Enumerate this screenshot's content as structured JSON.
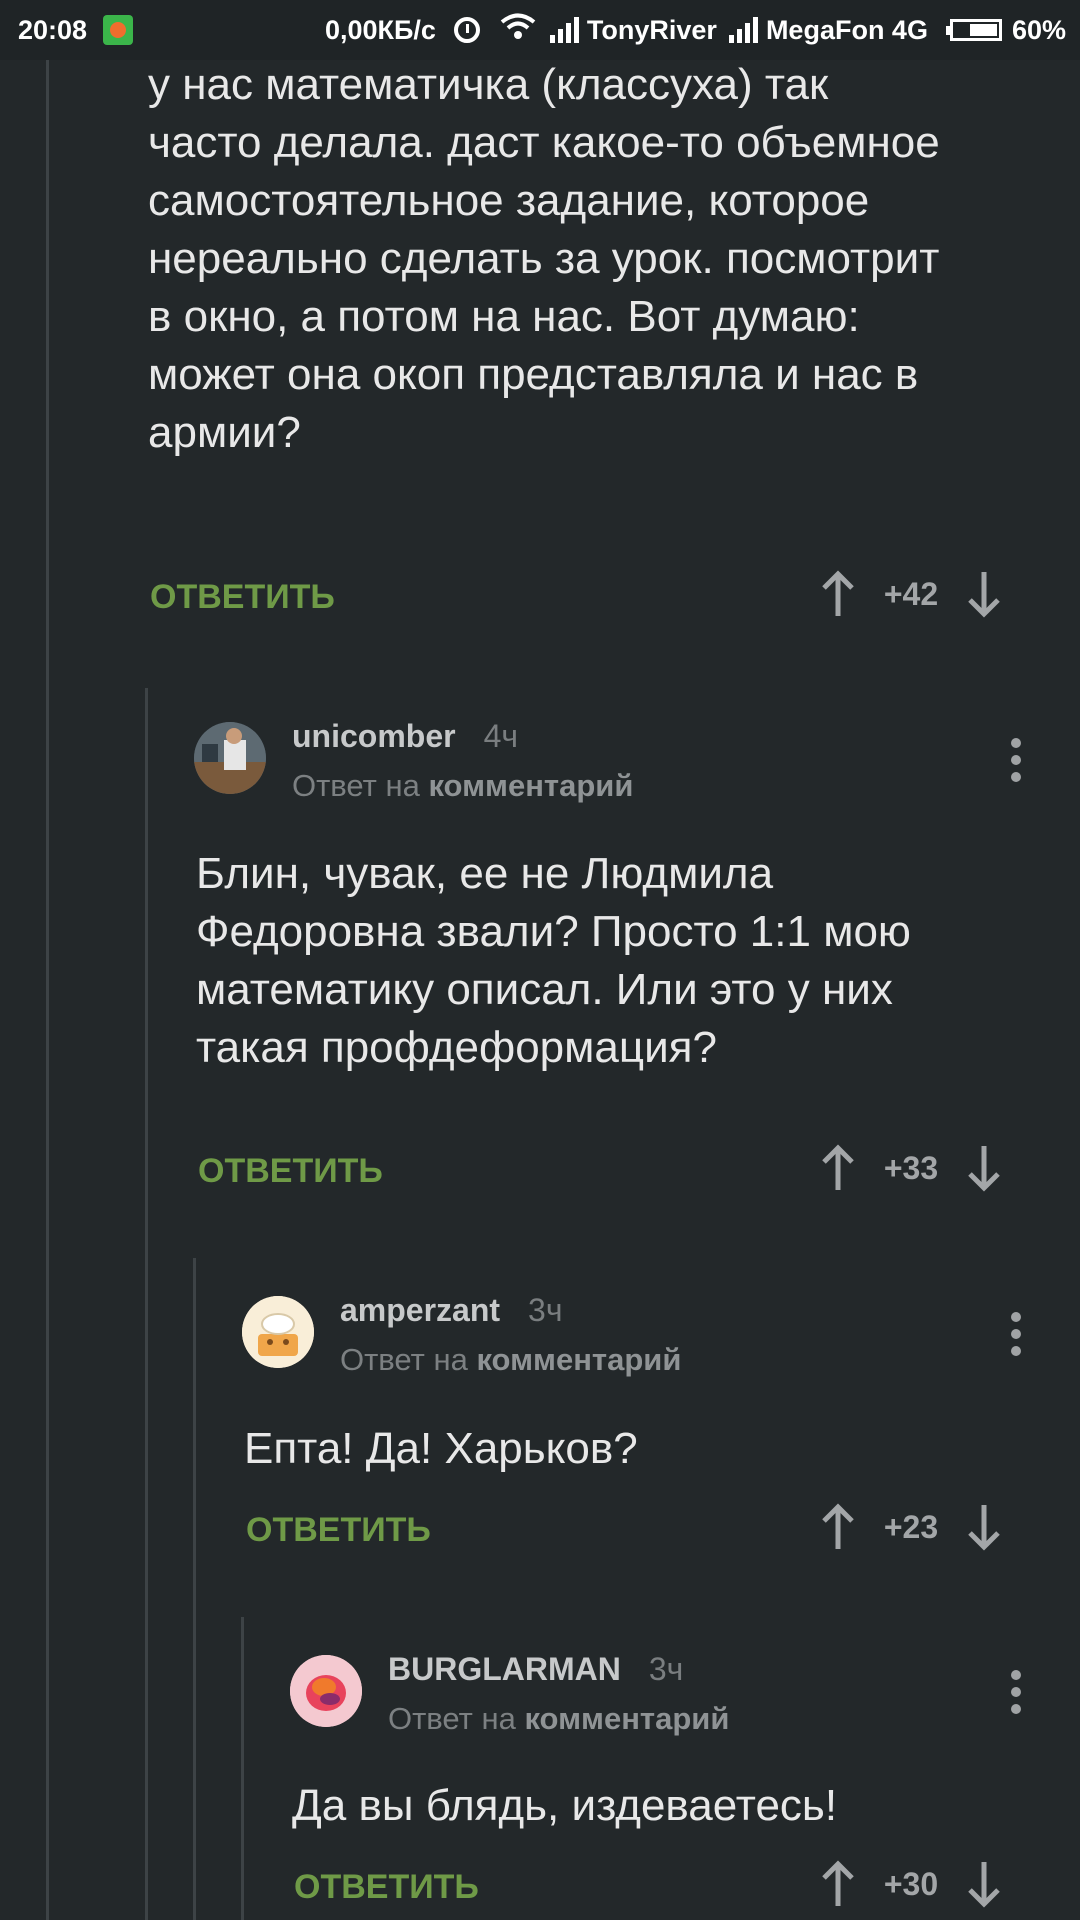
{
  "status_bar": {
    "time": "20:08",
    "speed": "0,00КБ/с",
    "carrier1": "TonyRiver",
    "carrier2": "MegaFon 4G",
    "battery": "60%",
    "battery_level": 0.6
  },
  "comments": [
    {
      "body": "у нас математичка (классуха) так\nчасто делала. даст какое-то объемное\nсамостоятельное задание, которое\nнереально сделать за урок. посмотрит\nв окно, а потом на нас. Вот думаю:\nможет она окоп представляла и нас в\nармии?",
      "reply_label": "ОТВЕТИТЬ",
      "score": "+42"
    },
    {
      "author": "unicomber",
      "time": "4ч",
      "reply_prefix": "Ответ на",
      "reply_target": "комментарий",
      "body": "Блин, чувак, ее не Людмила\nФедоровна звали? Просто 1:1 мою\nматематику описал. Или это у них\nтакая профдеформация?",
      "reply_label": "ОТВЕТИТЬ",
      "score": "+33"
    },
    {
      "author": "amperzant",
      "time": "3ч",
      "reply_prefix": "Ответ на",
      "reply_target": "комментарий",
      "body": "Епта! Да! Харьков?",
      "reply_label": "ОТВЕТИТЬ",
      "score": "+23"
    },
    {
      "author": "BURGLARMAN",
      "time": "3ч",
      "reply_prefix": "Ответ на",
      "reply_target": "комментарий",
      "body": "Да вы блядь, издеваетесь!",
      "reply_label": "ОТВЕТИТЬ",
      "score": "+30"
    }
  ],
  "icons": {
    "upvote": "arrow-up-icon",
    "downvote": "arrow-down-icon",
    "menu": "more-vertical-icon"
  },
  "colors": {
    "background": "#23282a",
    "reply_link": "#6f9a47",
    "text": "#e8e8e8"
  }
}
